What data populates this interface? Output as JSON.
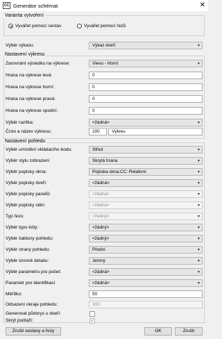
{
  "window": {
    "title": "Generátor schémat",
    "icon_text": "CC"
  },
  "variant": {
    "label": "Varianta vytvoření",
    "options": [
      "Vyvářet pomocí sestav",
      "Vyvářet pomocí řezů"
    ],
    "selected": 0
  },
  "drawing_select": {
    "label": "Výběr výkazu:",
    "value": "Výkaz dveří"
  },
  "drawing_settings": {
    "label": "Nastavení výkresu",
    "alignment": {
      "label": "Zarovnání výsledku na výkrese:",
      "value": "Vlevo - Horní"
    },
    "margins": [
      {
        "label": "Hrana na výkrese levá:",
        "value": "0"
      },
      {
        "label": "Hrana na výkrese horní:",
        "value": "0"
      },
      {
        "label": "Hrana na výkrese pravá:",
        "value": "0"
      },
      {
        "label": "Hrana na výkrese spodní:",
        "value": "0"
      }
    ],
    "stamp": {
      "label": "Výběr razítka:",
      "value": "<žádná>"
    },
    "number": {
      "label": "Číslo a název výkresu:",
      "number": "100",
      "name": "Výkres"
    }
  },
  "view_settings": {
    "label": "Nastavení pohledu",
    "rows": [
      {
        "label": "Výběr umístění vkládacího bodu:",
        "value": "Střed",
        "disabled": false
      },
      {
        "label": "Výběr stylu zobrazení",
        "value": "Skrytá hrana",
        "disabled": false
      },
      {
        "label": "Výběr popisky okna:",
        "value": "Popiska okna.CC: Relativní",
        "disabled": false
      },
      {
        "label": "Výběr popisky dveří:",
        "value": "<žádná>",
        "disabled": false
      },
      {
        "label": "Výběr popisky panelů:",
        "value": "<žádná>",
        "disabled": true
      },
      {
        "label": "Výběr popisky stěn:",
        "value": "<žádná>",
        "disabled": true
      },
      {
        "label": "Typ řezu:",
        "value": "<žádný>",
        "disabled": true
      },
      {
        "label": "Výběr typu kóty:",
        "value": "<žádný>",
        "disabled": false
      },
      {
        "label": "Výběr šablony pohledu:",
        "value": "<žádný>",
        "disabled": false
      },
      {
        "label": "Výběr strany pohledu:",
        "value": "Přední",
        "disabled": false
      },
      {
        "label": "Výběr úrovně detailu:",
        "value": "Jemný",
        "disabled": false
      },
      {
        "label": "Výběr parametru pro počet:",
        "value": "<žádná>",
        "disabled": false
      },
      {
        "label": "Parametr pro identifikaci",
        "value": "<žádná>",
        "disabled": false
      }
    ],
    "scale": {
      "label": "Měřítko:",
      "value": "50"
    },
    "offset": {
      "label": "Odsazení okraje pohledu:",
      "value": "100"
    },
    "floorplans": {
      "label": "Generovat půdorys u dveří:",
      "checked": false
    },
    "hide_floor": {
      "label": "Skrýt podlaží:",
      "checked": true
    }
  },
  "buttons": {
    "cancel_sets": "Zrušit sestavy a řezy",
    "ok": "OK",
    "cancel": "Zrušit"
  }
}
